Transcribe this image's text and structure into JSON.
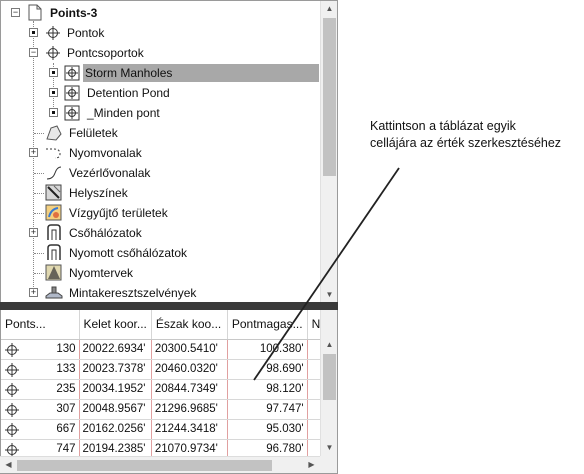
{
  "tree": {
    "root": {
      "label": "Points-3",
      "icon": "document-icon"
    },
    "items": [
      {
        "label": "Pontok",
        "icon": "point-icon"
      },
      {
        "label": "Pontcsoportok",
        "icon": "point-group-icon"
      },
      {
        "label": "Storm Manholes",
        "icon": "point-group-icon",
        "selected": true
      },
      {
        "label": "Detention Pond",
        "icon": "point-group-icon"
      },
      {
        "label": "_Minden pont",
        "icon": "point-group-icon"
      },
      {
        "label": "Felületek",
        "icon": "surface-icon"
      },
      {
        "label": "Nyomvonalak",
        "icon": "alignment-icon"
      },
      {
        "label": "Vezérlővonalak",
        "icon": "feature-line-icon"
      },
      {
        "label": "Helyszínek",
        "icon": "site-icon"
      },
      {
        "label": "Vízgyűjtő területek",
        "icon": "catchment-icon"
      },
      {
        "label": "Csőhálózatok",
        "icon": "pipe-network-icon"
      },
      {
        "label": "Nyomott csőhálózatok",
        "icon": "pressure-network-icon"
      },
      {
        "label": "Nyomtervek",
        "icon": "corridor-icon"
      },
      {
        "label": "Mintakeresztszelvények",
        "icon": "assembly-icon"
      }
    ]
  },
  "grid": {
    "columns": [
      "Ponts...",
      "Kelet koor...",
      "Észak koo...",
      "Pontmagas...",
      "N"
    ],
    "rows": [
      {
        "num": "130",
        "east": "20022.6934'",
        "north": "20300.5410'",
        "elev": "100.380'"
      },
      {
        "num": "133",
        "east": "20023.7378'",
        "north": "20460.0320'",
        "elev": "98.690'"
      },
      {
        "num": "235",
        "east": "20034.1952'",
        "north": "20844.7349'",
        "elev": "98.120'"
      },
      {
        "num": "307",
        "east": "20048.9567'",
        "north": "21296.9685'",
        "elev": "97.747'"
      },
      {
        "num": "667",
        "east": "20162.0256'",
        "north": "21244.3418'",
        "elev": "95.030'"
      },
      {
        "num": "747",
        "east": "20194.2385'",
        "north": "21070.9734'",
        "elev": "96.780'"
      }
    ]
  },
  "annotation": {
    "line1": "Kattintson a táblázat egyik",
    "line2": "cellájára az érték szerkesztéséhez"
  },
  "colors": {
    "selection": "#a8a8a8",
    "splitter": "#3a3a3a",
    "grid_border": "#e0a0a0"
  }
}
